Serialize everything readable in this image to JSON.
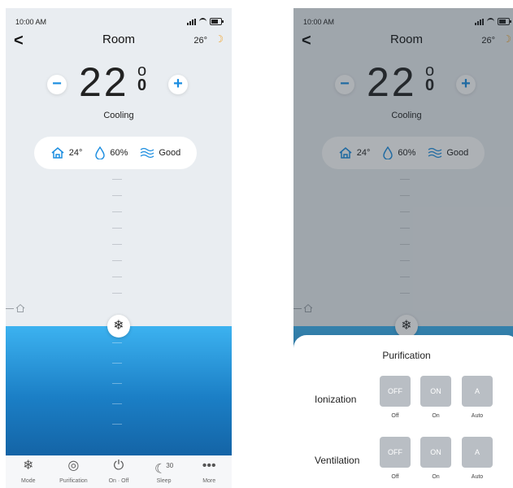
{
  "status": {
    "time": "10:00 AM"
  },
  "header": {
    "back": "<",
    "title": "Room",
    "outdoor_temp": "26°",
    "moon_icon": "moon-icon"
  },
  "setpoint": {
    "minus": "−",
    "plus": "+",
    "value": "22",
    "fraction_top": "o",
    "fraction_bottom": "0",
    "mode": "Cooling"
  },
  "conditions": {
    "indoor_temp": "24°",
    "humidity": "60%",
    "air_quality": "Good"
  },
  "tabbar": {
    "tabs": [
      {
        "label": "Mode",
        "icon": "mode-icon"
      },
      {
        "label": "Purification",
        "icon": "purification-icon"
      },
      {
        "label": "On · Off",
        "icon": "power-icon"
      },
      {
        "label": "Sleep",
        "icon": "sleep-icon",
        "badge": "30"
      },
      {
        "label": "More",
        "icon": "more-icon"
      }
    ]
  },
  "purification_sheet": {
    "title": "Purification",
    "ionization": {
      "label": "Ionization",
      "options": [
        "Off",
        "On",
        "Auto"
      ],
      "icon_texts": [
        "OFF",
        "ON",
        "A"
      ]
    },
    "ventilation": {
      "label": "Ventilation",
      "options": [
        "Off",
        "On",
        "Auto"
      ],
      "icon_texts": [
        "OFF",
        "ON",
        "A"
      ]
    }
  },
  "colors": {
    "accent": "#1b8de0",
    "fill_top": "#3cb2f0",
    "fill_bottom": "#1464a6",
    "moon": "#f2a42b"
  }
}
